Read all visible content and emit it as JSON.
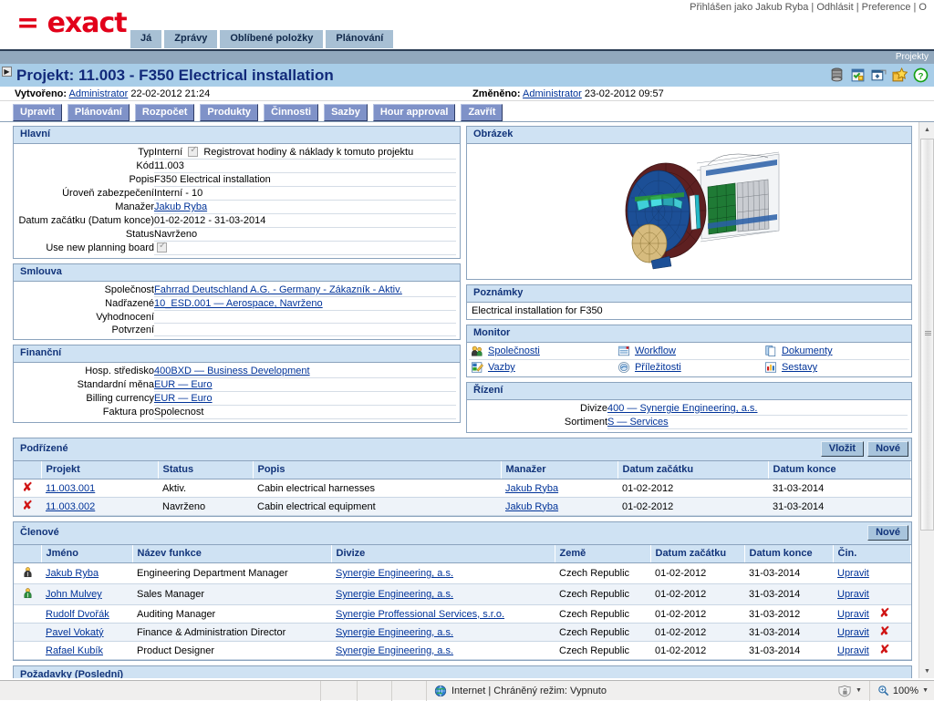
{
  "app": {
    "logo_text": "= exact",
    "user_bar": "Přihlášen jako Jakub Ryba | Odhlásit | Preference | O",
    "breadcrumb": "Projekty"
  },
  "nav_tabs": [
    {
      "label": "Já"
    },
    {
      "label": "Zprávy"
    },
    {
      "label": "Oblíbené položky"
    },
    {
      "label": "Plánování"
    }
  ],
  "title_bar": {
    "title": "Projekt: 11.003 - F350 Electrical installation",
    "icons": [
      "stack-icon",
      "checklist-icon",
      "new-window-icon",
      "favorite-star-icon",
      "help-icon"
    ]
  },
  "meta": {
    "created_label": "Vytvořeno:",
    "created_user": "Administrator",
    "created_date": "22-02-2012 21:24",
    "changed_label": "Změněno:",
    "changed_user": "Administrator",
    "changed_date": "23-02-2012 09:57"
  },
  "toolbar": [
    {
      "label": "Upravit"
    },
    {
      "label": "Plánování"
    },
    {
      "label": "Rozpočet"
    },
    {
      "label": "Produkty"
    },
    {
      "label": "Činnosti"
    },
    {
      "label": "Sazby"
    },
    {
      "label": "Hour approval"
    },
    {
      "label": "Zavřít"
    }
  ],
  "main_panel": {
    "title": "Hlavní",
    "rows": [
      {
        "label": "Typ",
        "value": "Interní",
        "checkbox": true,
        "checkbox_label": "Registrovat hodiny & náklady k tomuto projektu"
      },
      {
        "label": "Kód",
        "value": "11.003"
      },
      {
        "label": "Popis",
        "value": "F350 Electrical installation"
      },
      {
        "label": "Úroveň zabezpečení",
        "value": "Interní - 10"
      },
      {
        "label": "Manažer",
        "value": "Jakub Ryba",
        "link": true
      },
      {
        "label": "Datum začátku (Datum konce)",
        "value": "01-02-2012  -  31-03-2014"
      },
      {
        "label": "Status",
        "value": "Navrženo"
      }
    ],
    "planning_board_label": "Use new planning board"
  },
  "contract_panel": {
    "title": "Smlouva",
    "rows": [
      {
        "label": "Společnost",
        "value": "Fahrrad Deutschland A.G. - Germany - Zákazník - Aktiv.",
        "link": true
      },
      {
        "label": "Nadřazené",
        "value": "10_ESD.001 — Aerospace, Navrženo",
        "link": true
      },
      {
        "label": "Vyhodnocení",
        "value": ""
      },
      {
        "label": "Potvrzení",
        "value": ""
      }
    ]
  },
  "financial_panel": {
    "title": "Finanční",
    "rows": [
      {
        "label": "Hosp. středisko",
        "value": "400BXD — Business Development",
        "link": true
      },
      {
        "label": "Standardní měna",
        "value": "EUR — Euro",
        "link": true
      },
      {
        "label": "Billing currency",
        "value": "EUR — Euro",
        "link": true
      },
      {
        "label": "Faktura pro",
        "value": "Spolecnost"
      }
    ]
  },
  "image_panel": {
    "title": "Obrázek",
    "image_alt": "aircraft-fuselage-cad-render"
  },
  "notes_panel": {
    "title": "Poznámky",
    "text": "Electrical installation for F350"
  },
  "monitor_panel": {
    "title": "Monitor",
    "links": [
      {
        "label": "Společnosti",
        "icon": "company-people-icon"
      },
      {
        "label": "Workflow",
        "icon": "workflow-icon"
      },
      {
        "label": "Dokumenty",
        "icon": "documents-icon"
      },
      {
        "label": "Vazby",
        "icon": "links-icon"
      },
      {
        "label": "Příležitosti",
        "icon": "opportunities-icon"
      },
      {
        "label": "Sestavy",
        "icon": "reports-icon"
      }
    ]
  },
  "management_panel": {
    "title": "Řízení",
    "rows": [
      {
        "label": "Divize",
        "value": "400 — Synergie Engineering, a.s.",
        "link": true
      },
      {
        "label": "Sortiment",
        "value": "S — Services",
        "link": true
      }
    ]
  },
  "subordinates": {
    "title": "Podřízené",
    "buttons": [
      {
        "label": "Vložit"
      },
      {
        "label": "Nové"
      }
    ],
    "columns": [
      "",
      "Projekt",
      "Status",
      "Popis",
      "Manažer",
      "Datum začátku",
      "Datum konce"
    ],
    "rows": [
      {
        "delete": "✘",
        "project": "11.003.001",
        "status": "Aktiv.",
        "description": "Cabin electrical harnesses",
        "manager": "Jakub Ryba",
        "start": "01-02-2012",
        "end": "31-03-2014"
      },
      {
        "delete": "✘",
        "project": "11.003.002",
        "status": "Navrženo",
        "description": "Cabin electrical equipment",
        "manager": "Jakub Ryba",
        "start": "01-02-2012",
        "end": "31-03-2014"
      }
    ]
  },
  "members": {
    "title": "Členové",
    "buttons": [
      {
        "label": "Nové"
      }
    ],
    "columns": [
      "",
      "Jméno",
      "Název funkce",
      "Divize",
      "Země",
      "Datum začátku",
      "Datum konce",
      "Čin."
    ],
    "rows": [
      {
        "icon": "person-dark-icon",
        "name": "Jakub Ryba",
        "role": "Engineering Department Manager",
        "division": "Synergie Engineering, a.s.",
        "country": "Czech Republic",
        "start": "01-02-2012",
        "end": "31-03-2014",
        "action": "Upravit",
        "delete": ""
      },
      {
        "icon": "person-green-icon",
        "name": "John Mulvey",
        "role": "Sales Manager",
        "division": "Synergie Engineering, a.s.",
        "country": "Czech Republic",
        "start": "01-02-2012",
        "end": "31-03-2014",
        "action": "Upravit",
        "delete": ""
      },
      {
        "icon": "",
        "name": "Rudolf Dvořák",
        "role": "Auditing Manager",
        "division": "Synergie Proffessional Services, s.r.o.",
        "country": "Czech Republic",
        "start": "01-02-2012",
        "end": "31-03-2012",
        "action": "Upravit",
        "delete": "✘"
      },
      {
        "icon": "",
        "name": "Pavel Vokatý",
        "role": "Finance & Administration Director",
        "division": "Synergie Engineering, a.s.",
        "country": "Czech Republic",
        "start": "01-02-2012",
        "end": "31-03-2014",
        "action": "Upravit",
        "delete": "✘"
      },
      {
        "icon": "",
        "name": "Rafael Kubík",
        "role": "Product Designer",
        "division": "Synergie Engineering, a.s.",
        "country": "Czech Republic",
        "start": "01-02-2012",
        "end": "31-03-2014",
        "action": "Upravit",
        "delete": "✘"
      }
    ]
  },
  "requests": {
    "title": "Požadavky (Poslední)"
  },
  "status_bar": {
    "zone": "Internet | Chráněný režim: Vypnuto",
    "zoom": "100%"
  }
}
